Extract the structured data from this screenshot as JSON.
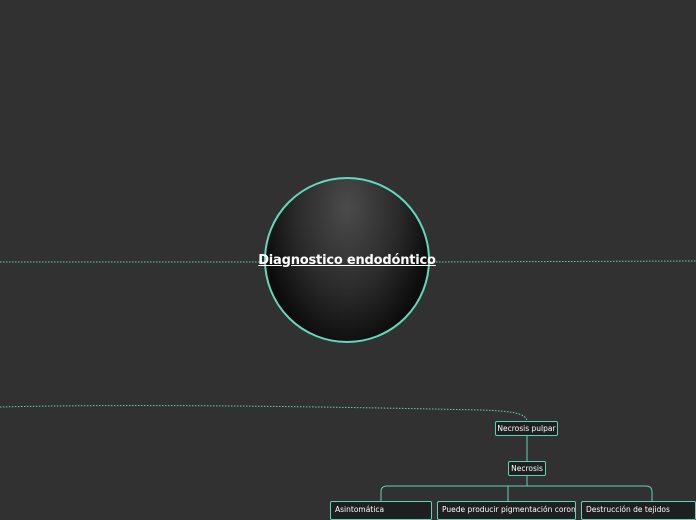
{
  "central_topic": "Diagnostico endodóntico",
  "nodes": {
    "necrosis_pulpar": "Necrosis pulpar",
    "necrosis": "Necrosis",
    "asintomatica": "Asintomática",
    "pigmentacion": "Puede producir pigmentación coronal",
    "destruccion": "Destrucción de tejidos"
  },
  "colors": {
    "background": "#323132",
    "accent": "#5fd3b5",
    "node_fill": "#1f1f1f"
  }
}
